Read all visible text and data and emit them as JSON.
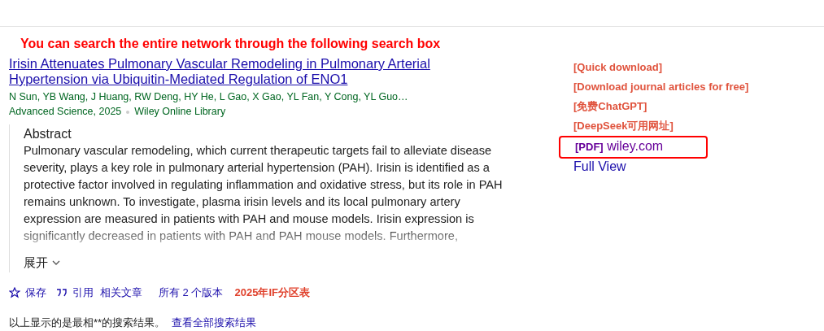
{
  "notice": "You can search the entire network through the following search box",
  "result": {
    "title": "Irisin Attenuates Pulmonary Vascular Remodeling in Pulmonary Arterial Hypertension via Ubiquitin-Mediated Regulation of ENO1",
    "authors": "N Sun, YB Wang, J Huang, RW Deng, HY He, L Gao, X Gao, YL Fan, Y Cong, YL Guo…",
    "journal": "Advanced Science, 2025",
    "site": "Wiley Online Library",
    "abstract_heading": "Abstract",
    "abstract": "Pulmonary vascular remodeling, which current therapeutic targets fail to alleviate disease severity, plays a key role in pulmonary arterial hypertension (PAH). Irisin is identified as a protective factor involved in regulating inflammation and oxidative stress, but its role in PAH remains unknown. To investigate, plasma irisin levels and its local pulmonary artery expression are measured in patients with PAH and mouse models. Irisin expression is significantly decreased in patients with PAH and PAH mouse models. Furthermore,",
    "expand": "展开",
    "actions": [
      {
        "kind": "save",
        "label": "保存"
      },
      {
        "kind": "cite",
        "label": "引用"
      },
      {
        "kind": "link",
        "label": "相关文章"
      },
      {
        "kind": "link",
        "label": "所有 2 个版本"
      },
      {
        "kind": "rank",
        "label": "2025年IF分区表"
      }
    ]
  },
  "side_links": [
    "[Quick download]",
    "[Download journal articles for free]",
    "[免费ChatGPT]",
    "[DeepSeek可用网址]"
  ],
  "pdf": {
    "tag": "[PDF]",
    "domain": "wiley.com",
    "highlighted": true
  },
  "full_view": "Full View",
  "footer": {
    "text": "以上显示的是最相**的搜索结果。",
    "link": "查看全部搜索结果"
  }
}
